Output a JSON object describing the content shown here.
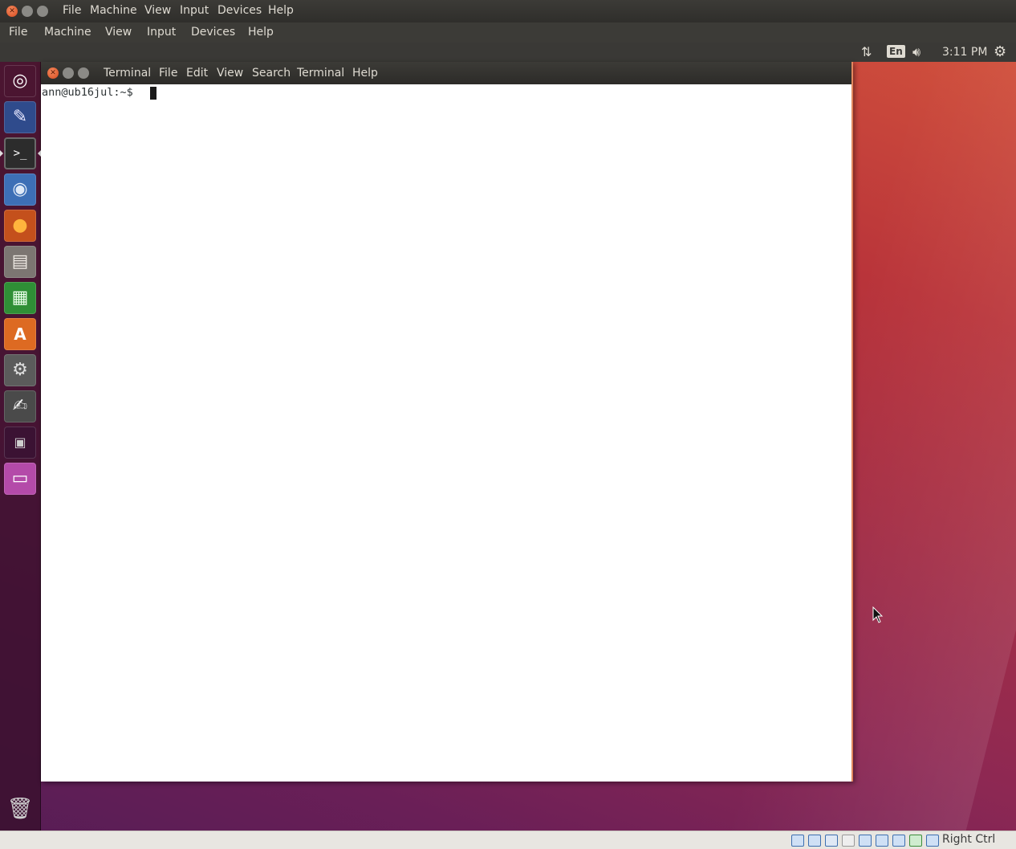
{
  "host_window": {
    "titlebar_menus": [
      "File",
      "Machine",
      "View",
      "Input",
      "Devices",
      "Help"
    ],
    "menubar": [
      "File",
      "Machine",
      "View",
      "Input",
      "Devices",
      "Help"
    ]
  },
  "top_panel": {
    "keyboard_layout": "En",
    "clock": "3:11 PM"
  },
  "launcher": {
    "items": [
      {
        "name": "ubuntu-dash-icon",
        "glyph": "◎",
        "bg": "#8c2a5a"
      },
      {
        "name": "emacs-icon",
        "glyph": "✎",
        "bg": "#3b5aa6"
      },
      {
        "name": "terminal-icon",
        "glyph": ">_",
        "bg": "#2c2c2c"
      },
      {
        "name": "chromium-icon",
        "glyph": "◉",
        "bg": "#5b8fd6"
      },
      {
        "name": "firefox-icon",
        "glyph": "●",
        "bg": "#e66a1d"
      },
      {
        "name": "files-icon",
        "glyph": "▤",
        "bg": "#8a8580"
      },
      {
        "name": "libreoffice-calc-icon",
        "glyph": "▦",
        "bg": "#2f9a3a"
      },
      {
        "name": "software-center-icon",
        "glyph": "A",
        "bg": "#e7742a"
      },
      {
        "name": "system-settings-icon",
        "glyph": "⚙",
        "bg": "#6d6d6d"
      },
      {
        "name": "text-editor-icon",
        "glyph": "✍",
        "bg": "#5a5a5a"
      },
      {
        "name": "workspace-switcher-icon",
        "glyph": "▣",
        "bg": "#4a1a3d"
      },
      {
        "name": "window-icon",
        "glyph": "▭",
        "bg": "#b84fb0"
      }
    ],
    "trash": {
      "name": "trash-icon",
      "glyph": "🗑"
    }
  },
  "terminal": {
    "title": "Terminal",
    "menus": [
      "File",
      "Edit",
      "View",
      "Search",
      "Terminal",
      "Help"
    ],
    "prompt": "ann@ub16jul:~$ "
  },
  "statusbar": {
    "host_key": "Right Ctrl"
  },
  "colors": {
    "accent_orange": "#e2875e",
    "panel_bg": "#3a3936"
  }
}
